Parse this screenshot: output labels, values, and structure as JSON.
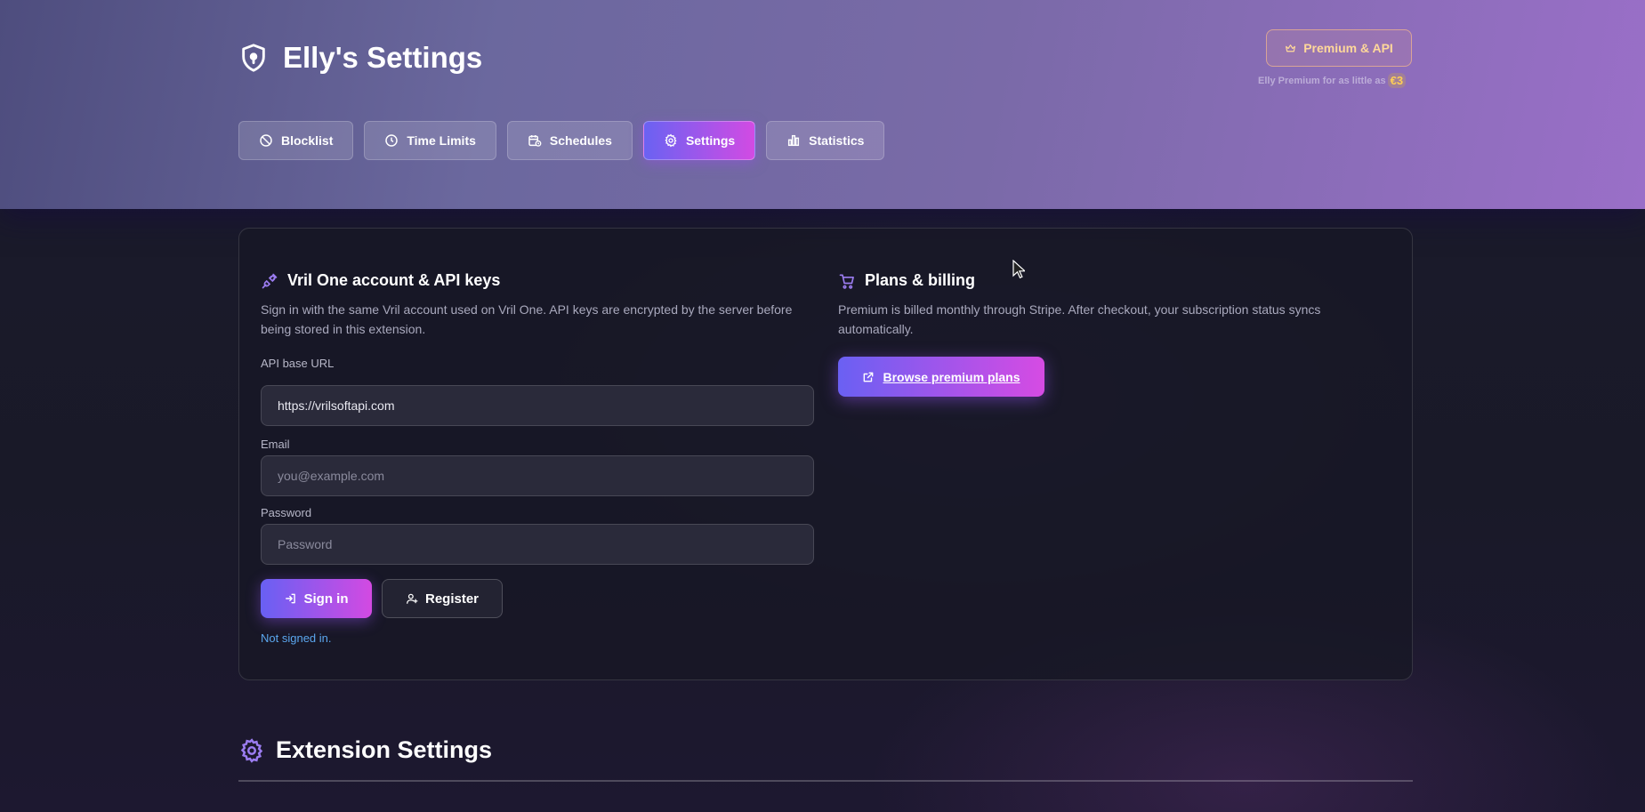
{
  "header": {
    "title": "Elly's Settings",
    "premium_button": "Premium & API",
    "premium_note": "Elly Premium for as little as",
    "premium_price": "€3",
    "accent_gold": "#ffd89a"
  },
  "tabs": [
    {
      "label": "Blocklist",
      "icon": "ban-icon",
      "active": false
    },
    {
      "label": "Time Limits",
      "icon": "clock-icon",
      "active": false
    },
    {
      "label": "Schedules",
      "icon": "calendar-clock-icon",
      "active": false
    },
    {
      "label": "Settings",
      "icon": "gear-icon",
      "active": true
    },
    {
      "label": "Statistics",
      "icon": "bar-chart-icon",
      "active": false
    }
  ],
  "account": {
    "title": "Vril One account & API keys",
    "description": "Sign in with the same Vril account used on Vril One. API keys are encrypted by the server before being stored in this extension.",
    "api_url_label": "API base URL",
    "api_url_value": "https://vrilsoftapi.com",
    "email_label": "Email",
    "email_placeholder": "you@example.com",
    "password_label": "Password",
    "password_placeholder": "Password",
    "sign_in_label": "Sign in",
    "register_label": "Register",
    "status_text": "Not signed in.",
    "status_color": "#5ba6ee"
  },
  "billing": {
    "title": "Plans & billing",
    "description": "Premium is billed monthly through Stripe. After checkout, your subscription status syncs automatically.",
    "browse_label": "Browse premium plans"
  },
  "extension": {
    "title": "Extension Settings"
  },
  "colors": {
    "accent_start": "#6a62f2",
    "accent_end": "#d24be3",
    "icon_purple": "#9b7cf0"
  }
}
